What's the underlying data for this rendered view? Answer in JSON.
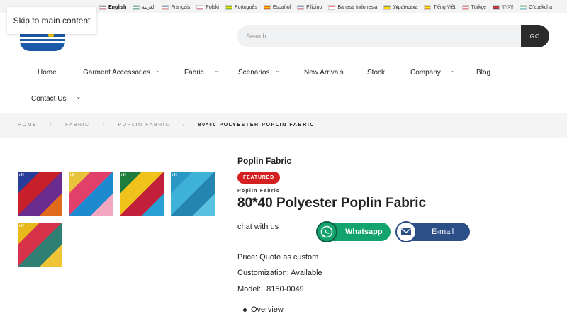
{
  "languages": [
    {
      "label": "English",
      "active": true,
      "flag": [
        "#3c3b6e",
        "#ffffff",
        "#b22234"
      ]
    },
    {
      "label": "العربية",
      "active": false,
      "flag": [
        "#006c35",
        "#ffffff",
        "#006c35"
      ]
    },
    {
      "label": "Français",
      "active": false,
      "flag": [
        "#0055a4",
        "#ffffff",
        "#ef4135"
      ]
    },
    {
      "label": "Polski",
      "active": false,
      "flag": [
        "#ffffff",
        "#ffffff",
        "#dc143c"
      ]
    },
    {
      "label": "Português",
      "active": false,
      "flag": [
        "#009c3b",
        "#ffdf00",
        "#009c3b"
      ]
    },
    {
      "label": "Español",
      "active": false,
      "flag": [
        "#c60b1e",
        "#ffc400",
        "#c60b1e"
      ]
    },
    {
      "label": "Filipino",
      "active": false,
      "flag": [
        "#0038a8",
        "#ffffff",
        "#ce1126"
      ]
    },
    {
      "label": "Bahasa Indonesia",
      "active": false,
      "flag": [
        "#ff0000",
        "#ffffff",
        "#ffffff"
      ]
    },
    {
      "label": "Українська",
      "active": false,
      "flag": [
        "#0057b7",
        "#ffd700",
        "#ffd700"
      ]
    },
    {
      "label": "Tiếng Việt",
      "active": false,
      "flag": [
        "#da251d",
        "#ffff00",
        "#da251d"
      ]
    },
    {
      "label": "Türkçe",
      "active": false,
      "flag": [
        "#e30a17",
        "#ffffff",
        "#e30a17"
      ]
    },
    {
      "label": "বাংলা",
      "active": false,
      "flag": [
        "#006a4e",
        "#f42a41",
        "#006a4e"
      ]
    },
    {
      "label": "O'zbekcha",
      "active": false,
      "flag": [
        "#1eb53a",
        "#ffffff",
        "#0099b5"
      ]
    }
  ],
  "skip_link": "Skip to main content",
  "search": {
    "placeholder": "Search",
    "button": "GO"
  },
  "nav": {
    "home": "Home",
    "garment_accessories": "Garment Accessories",
    "fabric": "Fabric",
    "scenarios": "Scenarios",
    "new_arrivals": "New Arrivals",
    "stock": "Stock",
    "company": "Company",
    "blog": "Blog",
    "contact_us": "Contact Us",
    "chevron": "⌄"
  },
  "breadcrumb": {
    "home": "HOME",
    "fabric": "FABRIC",
    "poplin": "POPLIN FABRIC",
    "current": "80*40 POLYESTER POPLIN FABRIC",
    "sep": "/"
  },
  "thumbnails": [
    {
      "tag": "nH",
      "colors": [
        "#2a3c9a",
        "#c8202a",
        "#6b2c8f",
        "#e26a1c"
      ]
    },
    {
      "tag": "nH",
      "colors": [
        "#e8c23a",
        "#e0406a",
        "#1d8ad0",
        "#f2a6c0"
      ]
    },
    {
      "tag": "nH",
      "colors": [
        "#1d7d3d",
        "#f0c21c",
        "#c21f3a",
        "#2a9fd6"
      ]
    },
    {
      "tag": "nH",
      "colors": [
        "#2a97c4",
        "#3fb2d9",
        "#2385b0",
        "#58c0e0"
      ]
    },
    {
      "tag": "nH",
      "colors": [
        "#e8b81c",
        "#d6334a",
        "#2f7f72",
        "#f0c437"
      ]
    }
  ],
  "product": {
    "category": "Poplin Fabric",
    "badge": "FEATURED",
    "sublabel": "Poplin Fabric",
    "title": "80*40 Polyester Poplin Fabric",
    "chat_label": "chat with us",
    "whatsapp_label": "Whatsapp",
    "email_label": "E-mail",
    "price": "Price: Quote as custom",
    "customization": "Customization: Available",
    "model_label": "Model:",
    "model_value": "8150-0049",
    "tabs": [
      "Overview"
    ]
  },
  "colors": {
    "badge": "#d42020",
    "whatsapp": "#12a36e",
    "email": "#2d4f88",
    "brand": "#1b5aa8"
  }
}
